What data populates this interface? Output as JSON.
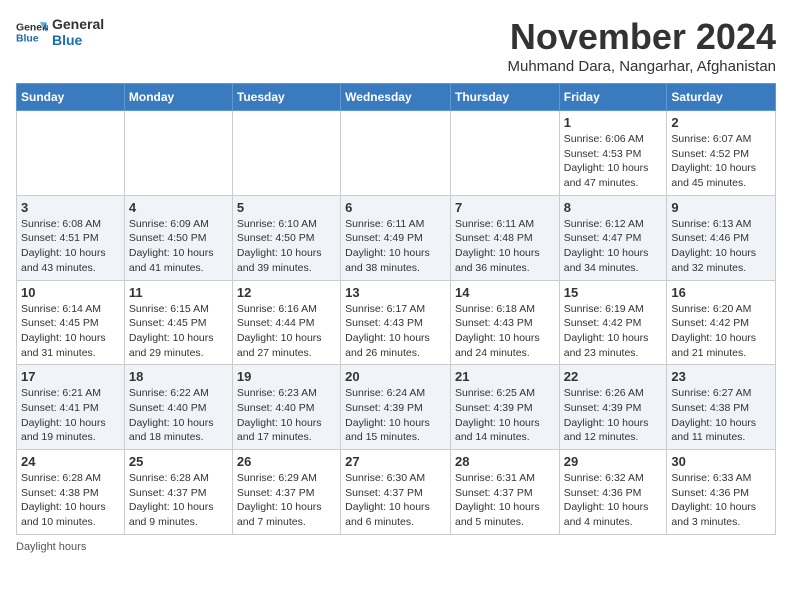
{
  "logo": {
    "line1": "General",
    "line2": "Blue"
  },
  "title": "November 2024",
  "location": "Muhmand Dara, Nangarhar, Afghanistan",
  "days_of_week": [
    "Sunday",
    "Monday",
    "Tuesday",
    "Wednesday",
    "Thursday",
    "Friday",
    "Saturday"
  ],
  "footer": "Daylight hours",
  "weeks": [
    [
      {
        "day": "",
        "info": ""
      },
      {
        "day": "",
        "info": ""
      },
      {
        "day": "",
        "info": ""
      },
      {
        "day": "",
        "info": ""
      },
      {
        "day": "",
        "info": ""
      },
      {
        "day": "1",
        "info": "Sunrise: 6:06 AM\nSunset: 4:53 PM\nDaylight: 10 hours\nand 47 minutes."
      },
      {
        "day": "2",
        "info": "Sunrise: 6:07 AM\nSunset: 4:52 PM\nDaylight: 10 hours\nand 45 minutes."
      }
    ],
    [
      {
        "day": "3",
        "info": "Sunrise: 6:08 AM\nSunset: 4:51 PM\nDaylight: 10 hours\nand 43 minutes."
      },
      {
        "day": "4",
        "info": "Sunrise: 6:09 AM\nSunset: 4:50 PM\nDaylight: 10 hours\nand 41 minutes."
      },
      {
        "day": "5",
        "info": "Sunrise: 6:10 AM\nSunset: 4:50 PM\nDaylight: 10 hours\nand 39 minutes."
      },
      {
        "day": "6",
        "info": "Sunrise: 6:11 AM\nSunset: 4:49 PM\nDaylight: 10 hours\nand 38 minutes."
      },
      {
        "day": "7",
        "info": "Sunrise: 6:11 AM\nSunset: 4:48 PM\nDaylight: 10 hours\nand 36 minutes."
      },
      {
        "day": "8",
        "info": "Sunrise: 6:12 AM\nSunset: 4:47 PM\nDaylight: 10 hours\nand 34 minutes."
      },
      {
        "day": "9",
        "info": "Sunrise: 6:13 AM\nSunset: 4:46 PM\nDaylight: 10 hours\nand 32 minutes."
      }
    ],
    [
      {
        "day": "10",
        "info": "Sunrise: 6:14 AM\nSunset: 4:45 PM\nDaylight: 10 hours\nand 31 minutes."
      },
      {
        "day": "11",
        "info": "Sunrise: 6:15 AM\nSunset: 4:45 PM\nDaylight: 10 hours\nand 29 minutes."
      },
      {
        "day": "12",
        "info": "Sunrise: 6:16 AM\nSunset: 4:44 PM\nDaylight: 10 hours\nand 27 minutes."
      },
      {
        "day": "13",
        "info": "Sunrise: 6:17 AM\nSunset: 4:43 PM\nDaylight: 10 hours\nand 26 minutes."
      },
      {
        "day": "14",
        "info": "Sunrise: 6:18 AM\nSunset: 4:43 PM\nDaylight: 10 hours\nand 24 minutes."
      },
      {
        "day": "15",
        "info": "Sunrise: 6:19 AM\nSunset: 4:42 PM\nDaylight: 10 hours\nand 23 minutes."
      },
      {
        "day": "16",
        "info": "Sunrise: 6:20 AM\nSunset: 4:42 PM\nDaylight: 10 hours\nand 21 minutes."
      }
    ],
    [
      {
        "day": "17",
        "info": "Sunrise: 6:21 AM\nSunset: 4:41 PM\nDaylight: 10 hours\nand 19 minutes."
      },
      {
        "day": "18",
        "info": "Sunrise: 6:22 AM\nSunset: 4:40 PM\nDaylight: 10 hours\nand 18 minutes."
      },
      {
        "day": "19",
        "info": "Sunrise: 6:23 AM\nSunset: 4:40 PM\nDaylight: 10 hours\nand 17 minutes."
      },
      {
        "day": "20",
        "info": "Sunrise: 6:24 AM\nSunset: 4:39 PM\nDaylight: 10 hours\nand 15 minutes."
      },
      {
        "day": "21",
        "info": "Sunrise: 6:25 AM\nSunset: 4:39 PM\nDaylight: 10 hours\nand 14 minutes."
      },
      {
        "day": "22",
        "info": "Sunrise: 6:26 AM\nSunset: 4:39 PM\nDaylight: 10 hours\nand 12 minutes."
      },
      {
        "day": "23",
        "info": "Sunrise: 6:27 AM\nSunset: 4:38 PM\nDaylight: 10 hours\nand 11 minutes."
      }
    ],
    [
      {
        "day": "24",
        "info": "Sunrise: 6:28 AM\nSunset: 4:38 PM\nDaylight: 10 hours\nand 10 minutes."
      },
      {
        "day": "25",
        "info": "Sunrise: 6:28 AM\nSunset: 4:37 PM\nDaylight: 10 hours\nand 9 minutes."
      },
      {
        "day": "26",
        "info": "Sunrise: 6:29 AM\nSunset: 4:37 PM\nDaylight: 10 hours\nand 7 minutes."
      },
      {
        "day": "27",
        "info": "Sunrise: 6:30 AM\nSunset: 4:37 PM\nDaylight: 10 hours\nand 6 minutes."
      },
      {
        "day": "28",
        "info": "Sunrise: 6:31 AM\nSunset: 4:37 PM\nDaylight: 10 hours\nand 5 minutes."
      },
      {
        "day": "29",
        "info": "Sunrise: 6:32 AM\nSunset: 4:36 PM\nDaylight: 10 hours\nand 4 minutes."
      },
      {
        "day": "30",
        "info": "Sunrise: 6:33 AM\nSunset: 4:36 PM\nDaylight: 10 hours\nand 3 minutes."
      }
    ]
  ]
}
